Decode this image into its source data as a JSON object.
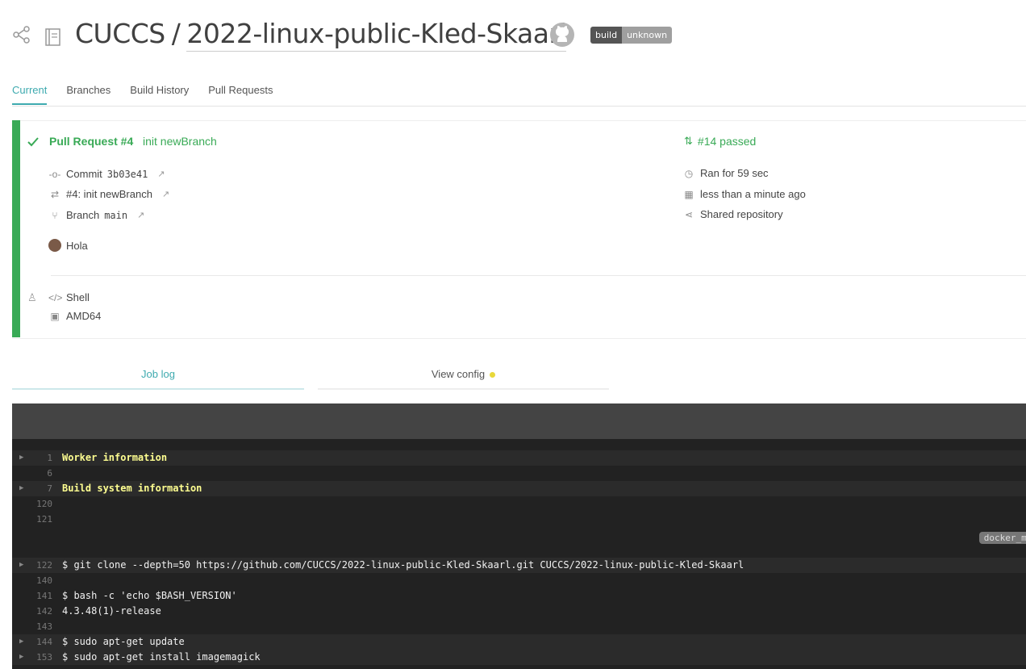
{
  "header": {
    "owner": "CUCCS",
    "separator": "/",
    "repo": "2022-linux-public-Kled-Skaarl",
    "badge_left": "build",
    "badge_right": "unknown"
  },
  "tabs": [
    "Current",
    "Branches",
    "Build History",
    "Pull Requests"
  ],
  "build": {
    "title": "Pull Request #4",
    "message": "init newBranch",
    "commit_label": "Commit",
    "commit_hash": "3b03e41",
    "pr_label": "#4: init newBranch",
    "branch_label": "Branch",
    "branch_name": "main",
    "author": "Hola",
    "language": "Shell",
    "arch": "AMD64",
    "status": "#14 passed",
    "duration": "Ran for 59 sec",
    "finished": "less than a minute ago",
    "shared": "Shared repository",
    "status_color": "#39aa56"
  },
  "log_tabs": {
    "job_log": "Job log",
    "view_config": "View config"
  },
  "log": {
    "tag": "docker_mtu",
    "lines": [
      {
        "n": "1",
        "text": "Worker information",
        "fold": true,
        "yellow": true
      },
      {
        "n": "6",
        "text": "",
        "fold": false,
        "yellow": false
      },
      {
        "n": "7",
        "text": "Build system information",
        "fold": true,
        "yellow": true
      },
      {
        "n": "120",
        "text": "",
        "fold": false,
        "yellow": false
      },
      {
        "n": "121",
        "text": "",
        "fold": false,
        "yellow": false
      },
      {
        "n": "",
        "text": "",
        "fold": false,
        "yellow": false,
        "tag": true
      },
      {
        "n": "",
        "text": "",
        "fold": false,
        "yellow": false
      },
      {
        "n": "122",
        "text": "$ git clone --depth=50 https://github.com/CUCCS/2022-linux-public-Kled-Skaarl.git CUCCS/2022-linux-public-Kled-Skaarl",
        "fold": true,
        "yellow": false
      },
      {
        "n": "140",
        "text": "",
        "fold": false,
        "yellow": false
      },
      {
        "n": "141",
        "text": "$ bash -c 'echo $BASH_VERSION'",
        "fold": false,
        "yellow": false
      },
      {
        "n": "142",
        "text": "4.3.48(1)-release",
        "fold": false,
        "yellow": false
      },
      {
        "n": "143",
        "text": "",
        "fold": false,
        "yellow": false
      },
      {
        "n": "144",
        "text": "$ sudo apt-get update",
        "fold": true,
        "yellow": false
      },
      {
        "n": "153",
        "text": "$ sudo apt-get install imagemagick",
        "fold": true,
        "yellow": false
      }
    ]
  }
}
